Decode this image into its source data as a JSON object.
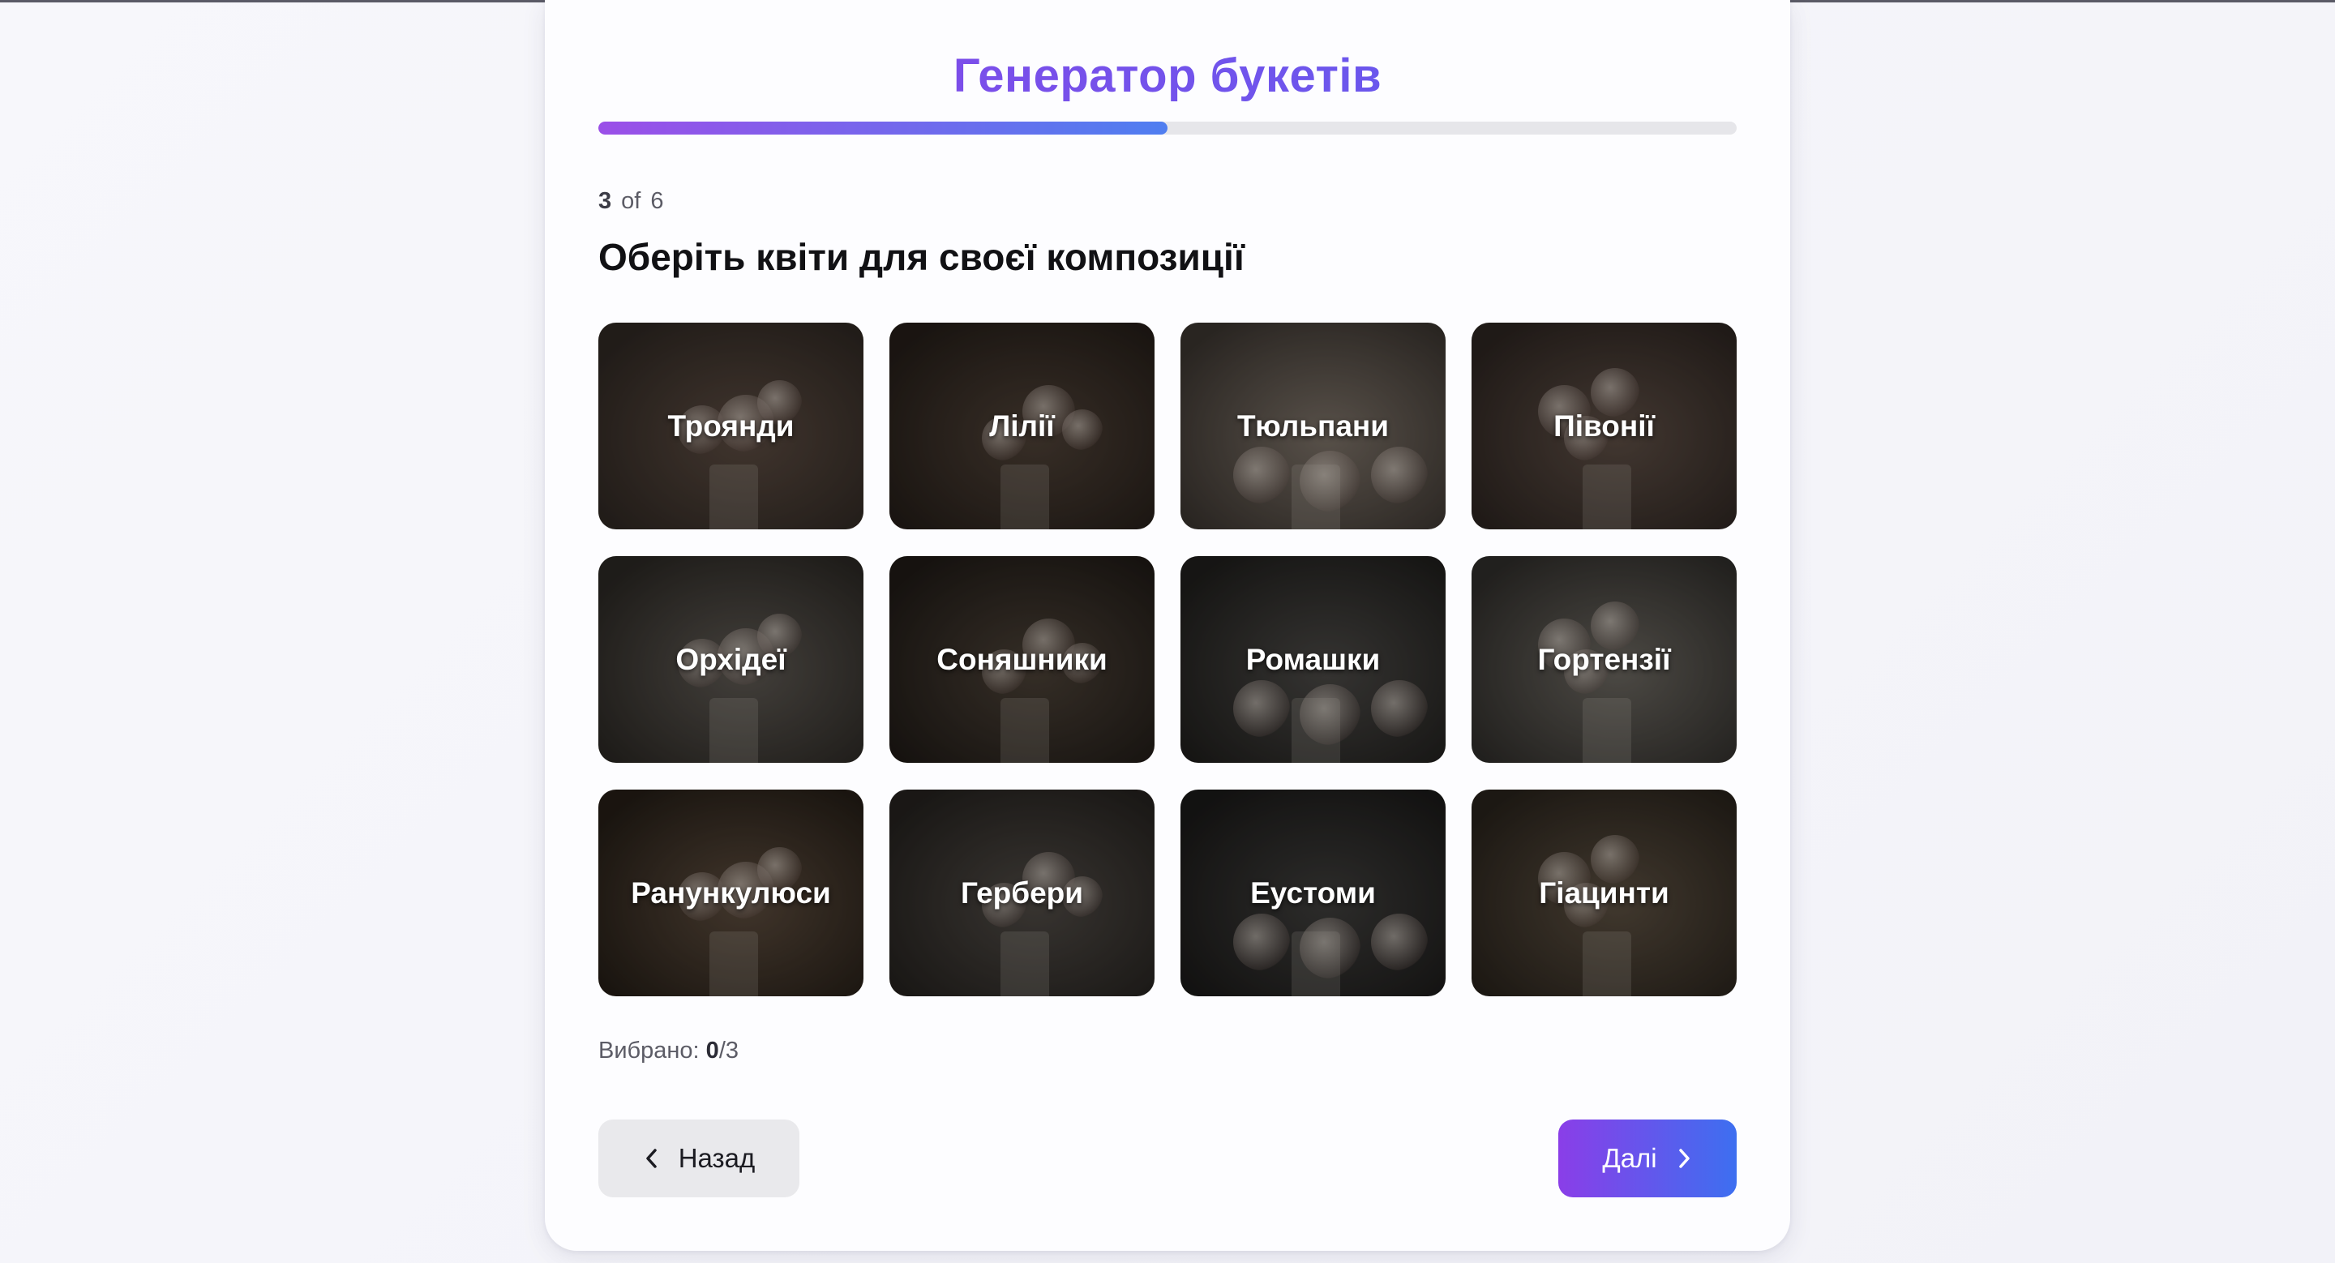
{
  "header": {
    "title": "Генератор букетів"
  },
  "progress": {
    "value": 0.5
  },
  "step": {
    "current": "3",
    "of": "of",
    "total": "6"
  },
  "question": "Оберіть квіти для своєї композиції",
  "flowers": [
    {
      "label": "Троянди",
      "colors": [
        "#5a4a40",
        "#2e2722"
      ]
    },
    {
      "label": "Лілії",
      "colors": [
        "#4d4036",
        "#241d18"
      ]
    },
    {
      "label": "Тюльпани",
      "colors": [
        "#7a7066",
        "#3a342f"
      ]
    },
    {
      "label": "Півонії",
      "colors": [
        "#5c4d44",
        "#2c2420"
      ]
    },
    {
      "label": "Орхідеї",
      "colors": [
        "#5d5852",
        "#2a2723"
      ]
    },
    {
      "label": "Соняшники",
      "colors": [
        "#4a4036",
        "#1f1a16"
      ]
    },
    {
      "label": "Ромашки",
      "colors": [
        "#4a4845",
        "#1f1e1c"
      ]
    },
    {
      "label": "Гортензії",
      "colors": [
        "#6a665f",
        "#2f2d2a"
      ]
    },
    {
      "label": "Ранункулюси",
      "colors": [
        "#5a4a3c",
        "#241d16"
      ]
    },
    {
      "label": "Гербери",
      "colors": [
        "#4e4944",
        "#24211e"
      ]
    },
    {
      "label": "Еустоми",
      "colors": [
        "#3e3d3b",
        "#1a1918"
      ]
    },
    {
      "label": "Гіацинти",
      "colors": [
        "#5a4e40",
        "#28221b"
      ]
    }
  ],
  "selection": {
    "label": "Вибрано:",
    "count": "0",
    "max": "/3"
  },
  "buttons": {
    "back": "Назад",
    "next": "Далі"
  }
}
